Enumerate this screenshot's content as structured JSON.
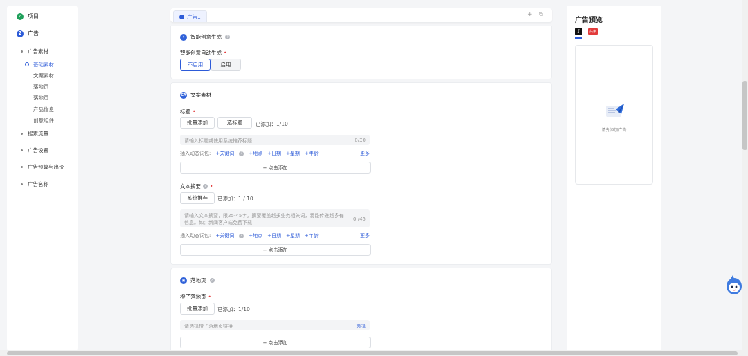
{
  "nav": {
    "steps": [
      {
        "label": "项目",
        "state": "done"
      },
      {
        "label": "广告",
        "number": "2"
      }
    ],
    "items": [
      "广告素材",
      "搜索流量",
      "广告设置",
      "广告预算与出价",
      "广告名称"
    ],
    "subitems": [
      "基础素材",
      "文案素材",
      "落地页",
      "落地页",
      "产品信息",
      "创意组件"
    ]
  },
  "tabs": [
    {
      "label": "广告1"
    }
  ],
  "tab_actions": {
    "add": "+",
    "copy": "⧉"
  },
  "smart": {
    "title": "智能创意生成",
    "field_label": "智能创意自动生成",
    "options": [
      "不启用",
      "启用"
    ]
  },
  "copy": {
    "title": "文案素材",
    "icon_text": "CA",
    "headline": {
      "label": "标题",
      "btn_bulk": "批量添加",
      "btn_pick": "选标题",
      "counter": "已添加：1/10",
      "placeholder": "请输入标题或使用系统推荐标题",
      "count": "0/30"
    },
    "dyn_label": "插入动态词包:",
    "dyn_links": [
      "+关键词",
      "+地点",
      "+日期",
      "+星期",
      "+年龄"
    ],
    "more": "更多",
    "add_click": "+ 点击添加",
    "summary": {
      "label": "文本摘要",
      "btn_recommend": "系统推荐",
      "counter": "已添加：1 / 10",
      "placeholder_line1": "请输入文本摘要，限25-45字。摘要覆盖越多业务相关词，將能传递越多有效",
      "placeholder_line2": "信息。如：新闻客户端免费下载",
      "count": "0 /45"
    }
  },
  "landing": {
    "title": "落地页",
    "field_label": "橙子落地页",
    "btn_bulk": "批量添加",
    "counter": "已添加：1/10",
    "placeholder": "请选择橙子落地页链接",
    "select": "选择",
    "add_click": "+ 点击添加"
  },
  "preview": {
    "title": "广告预览",
    "platform_icon": "tiktok-icon",
    "platform_glyph": "♪",
    "badge": "头条",
    "empty_text": "请先添加广告"
  },
  "colors": {
    "accent": "#2d5bd8",
    "success": "#1fa05a",
    "required": "#e23b3b"
  }
}
